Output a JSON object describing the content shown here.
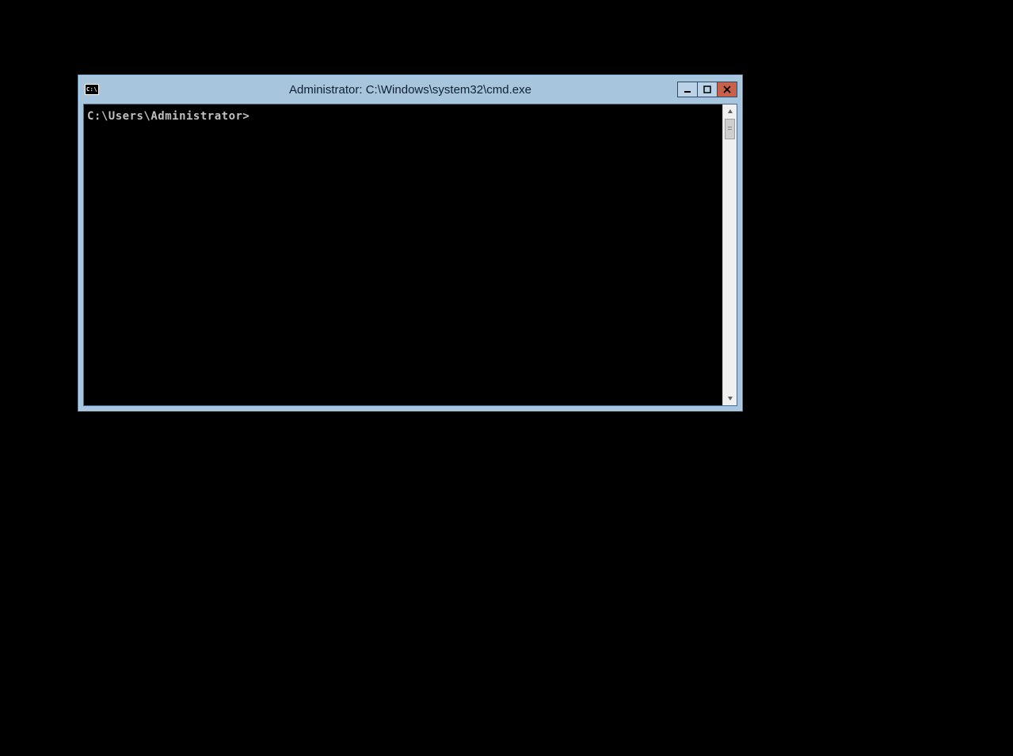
{
  "window": {
    "title": "Administrator: C:\\Windows\\system32\\cmd.exe",
    "sys_icon_text": "C:\\"
  },
  "terminal": {
    "prompt": "C:\\Users\\Administrator>"
  }
}
